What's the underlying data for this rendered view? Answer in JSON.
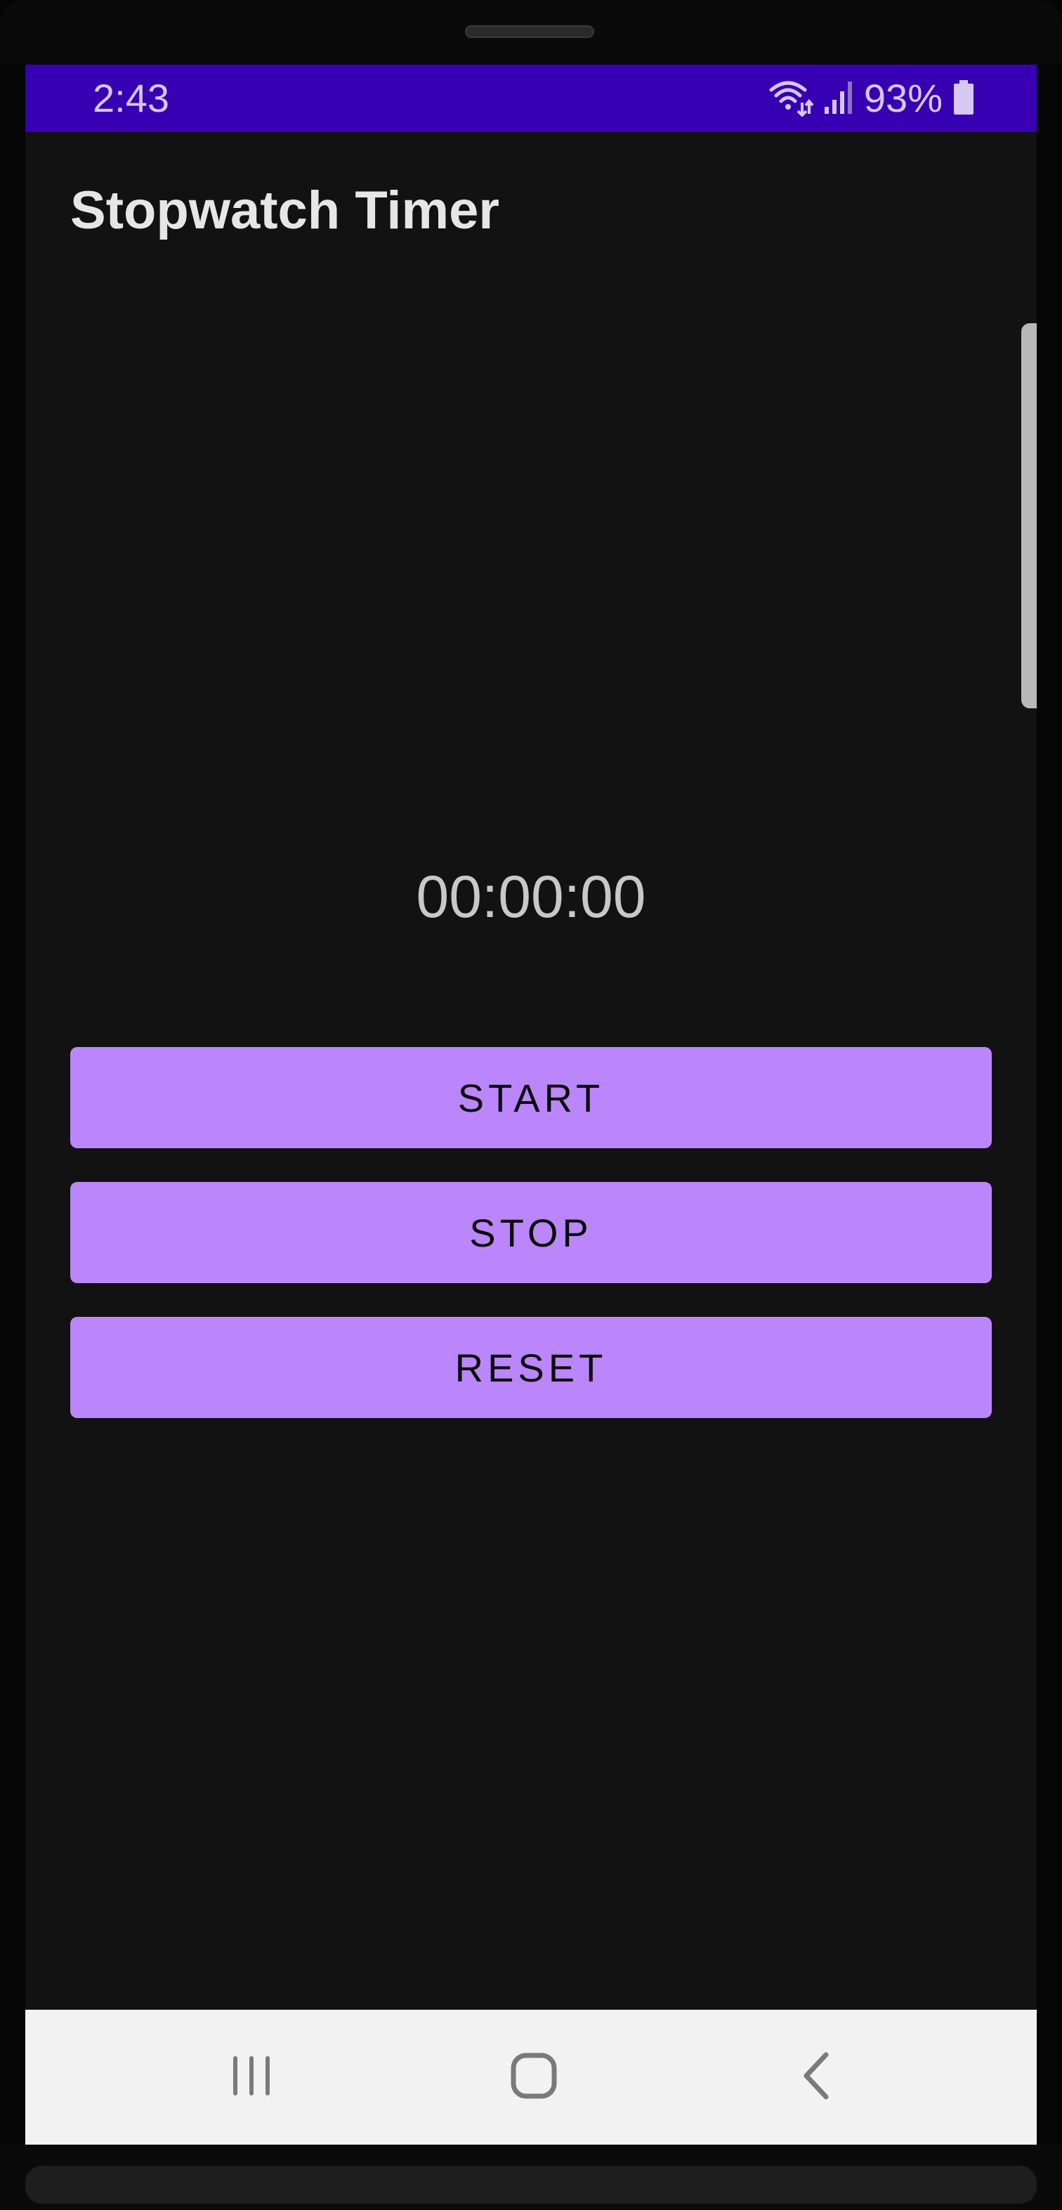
{
  "status_bar": {
    "time": "2:43",
    "battery_percent": "93%",
    "background_color": "#3700b3",
    "icons": [
      "wifi-icon",
      "signal-icon",
      "battery-icon"
    ]
  },
  "app": {
    "title": "Stopwatch Timer"
  },
  "timer": {
    "display": "00:00:00"
  },
  "buttons": {
    "start_label": "START",
    "stop_label": "STOP",
    "reset_label": "RESET",
    "color": "#bb86fc"
  },
  "nav_bar": {
    "icons": [
      "recents-icon",
      "home-icon",
      "back-icon"
    ]
  }
}
